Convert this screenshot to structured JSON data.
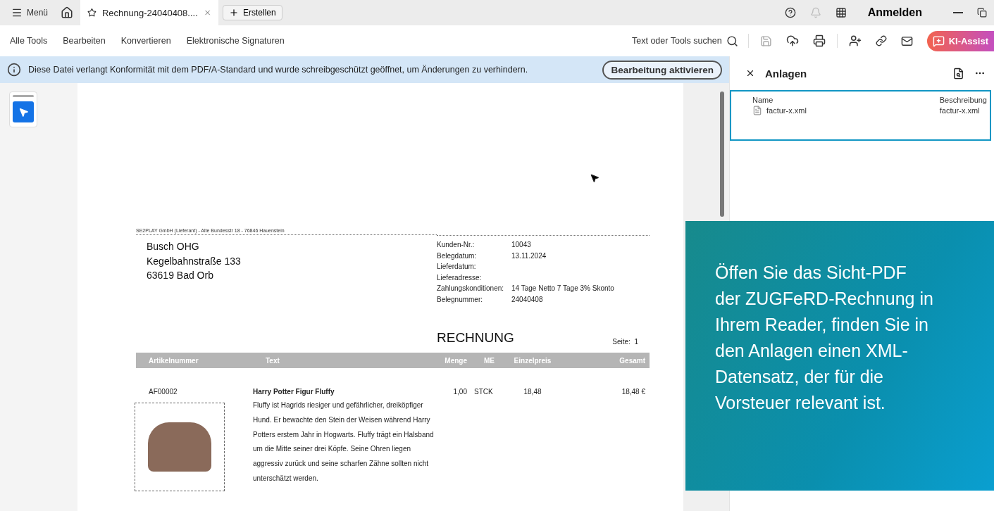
{
  "title_bar": {
    "menu": "Menü",
    "tab": {
      "title": "Rechnung-24040408....",
      "selected": true
    },
    "create_button": "Erstellen",
    "sign_in": "Anmelden"
  },
  "toolbar": {
    "items": [
      "Alle Tools",
      "Bearbeiten",
      "Konvertieren",
      "Elektronische Signaturen"
    ],
    "search": "Text oder Tools suchen",
    "ai_button": "KI-Assist"
  },
  "notice": {
    "text": "Diese Datei verlangt Konformität mit dem PDF/A-Standard und wurde schreibgeschützt geöffnet, um Änderungen zu verhindern.",
    "button": "Bearbeitung aktivieren"
  },
  "attachments_panel": {
    "title": "Anlagen",
    "columns": [
      "Name",
      "Beschreibung"
    ],
    "rows": [
      {
        "name": "factur-x.xml",
        "description": "factur-x.xml"
      }
    ]
  },
  "document": {
    "sender": "SE2PLAY GmbH (Lieferant) - Alte Bundesstr 18 - 76846 Hauenstein",
    "address": [
      "Busch OHG",
      "Kegelbahnstraße 133",
      "63619 Bad Orb"
    ],
    "fields": [
      {
        "label": "Kunden-Nr.:",
        "value": "10043"
      },
      {
        "label": "Belegdatum:",
        "value": "13.11.2024"
      },
      {
        "label": "Lieferdatum:"
      },
      {
        "label": "Lieferadresse:"
      },
      {
        "label": "Zahlungskonditionen:",
        "value": "14 Tage Netto 7 Tage 3% Skonto"
      },
      {
        "label": "Belegnummer:",
        "value": "24040408"
      }
    ],
    "title": "RECHNUNG",
    "page_label": "Seite:",
    "page_number": "1",
    "table": {
      "columns": [
        "Artikelnummer",
        "Text",
        "Menge",
        "ME",
        "Einzelpreis",
        "Gesamt"
      ],
      "rows": [
        {
          "article": "AF00002",
          "name": "Harry Potter Figur Fluffy",
          "description": "Fluffy ist Hagrids riesiger und gefährlicher, dreiköpfiger Hund. Er bewachte den Stein der Weisen während Harry Potters erstem Jahr in Hogwarts. Fluffy trägt ein Halsband um die Mitte seiner drei Köpfe. Seine Ohren liegen aggressiv zurück und seine scharfen Zähne sollten nicht unterschätzt werden.",
          "quantity": "1,00",
          "unit": "STCK",
          "unit_price": "18,48",
          "total": "18,48 €"
        }
      ]
    }
  },
  "callout": {
    "text": "Öffen Sie das Sicht-PDF der ZUGFeRD-Rechnung in Ihrem Reader, finden Sie in den Anlagen einen XML-Datensatz, der für die Vorsteuer relevant ist."
  }
}
